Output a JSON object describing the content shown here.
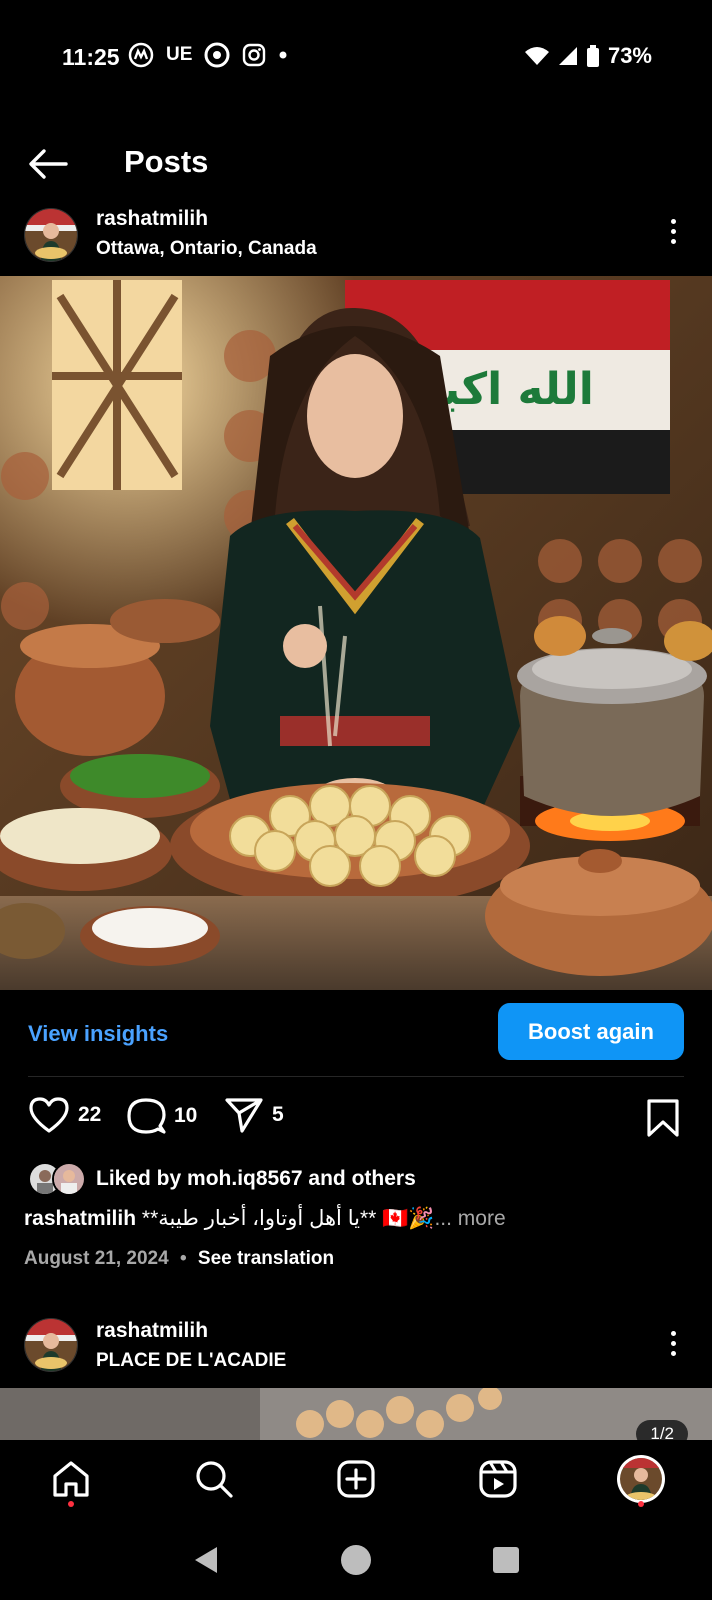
{
  "status_bar": {
    "time": "11:25",
    "carrier_icons": [
      "UE"
    ],
    "battery": "73%"
  },
  "header": {
    "title": "Posts"
  },
  "post1": {
    "username": "rashatmilih",
    "location": "Ottawa, Ontario, Canada",
    "image_flag_text": "الله اكبر",
    "view_insights": "View insights",
    "boost_again": "Boost again",
    "likes": "22",
    "comments": "10",
    "shares": "5",
    "liked_by_prefix": "Liked by ",
    "liked_by_user": "moh.iq8567",
    "liked_by_suffix": " and others",
    "caption_user": "rashatmilih",
    "caption_text": "**يا أهل أوتاوا، أخبار طيبة** 🇨🇦🎉",
    "caption_more": "... more",
    "date": "August 21, 2024",
    "separator": "•",
    "see_translation": "See translation"
  },
  "post2": {
    "username": "rashatmilih",
    "location": "PLACE DE L'ACADIE",
    "page_badge": "1/2"
  },
  "colors": {
    "accent": "#0f95f6",
    "link": "#4aa2ff",
    "notification": "#ff3040"
  }
}
